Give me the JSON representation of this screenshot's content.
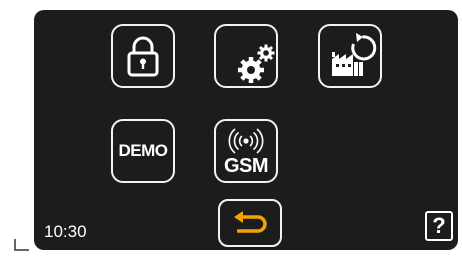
{
  "screen": {
    "background_color": "#1c1c1c",
    "icon_color": "#ffffff",
    "accent_color": "#f5a100"
  },
  "menu": {
    "lock": {
      "icon": "padlock-icon"
    },
    "settings": {
      "icon": "gears-icon"
    },
    "factory_reset": {
      "icon": "factory-reset-icon"
    },
    "demo": {
      "icon": "demo-icon",
      "label": "DEMO"
    },
    "gsm": {
      "icon": "gsm-signal-icon",
      "label": "GSM"
    },
    "back": {
      "icon": "back-arrow-icon"
    }
  },
  "status_bar": {
    "time": "10:30",
    "help_label": "?"
  }
}
